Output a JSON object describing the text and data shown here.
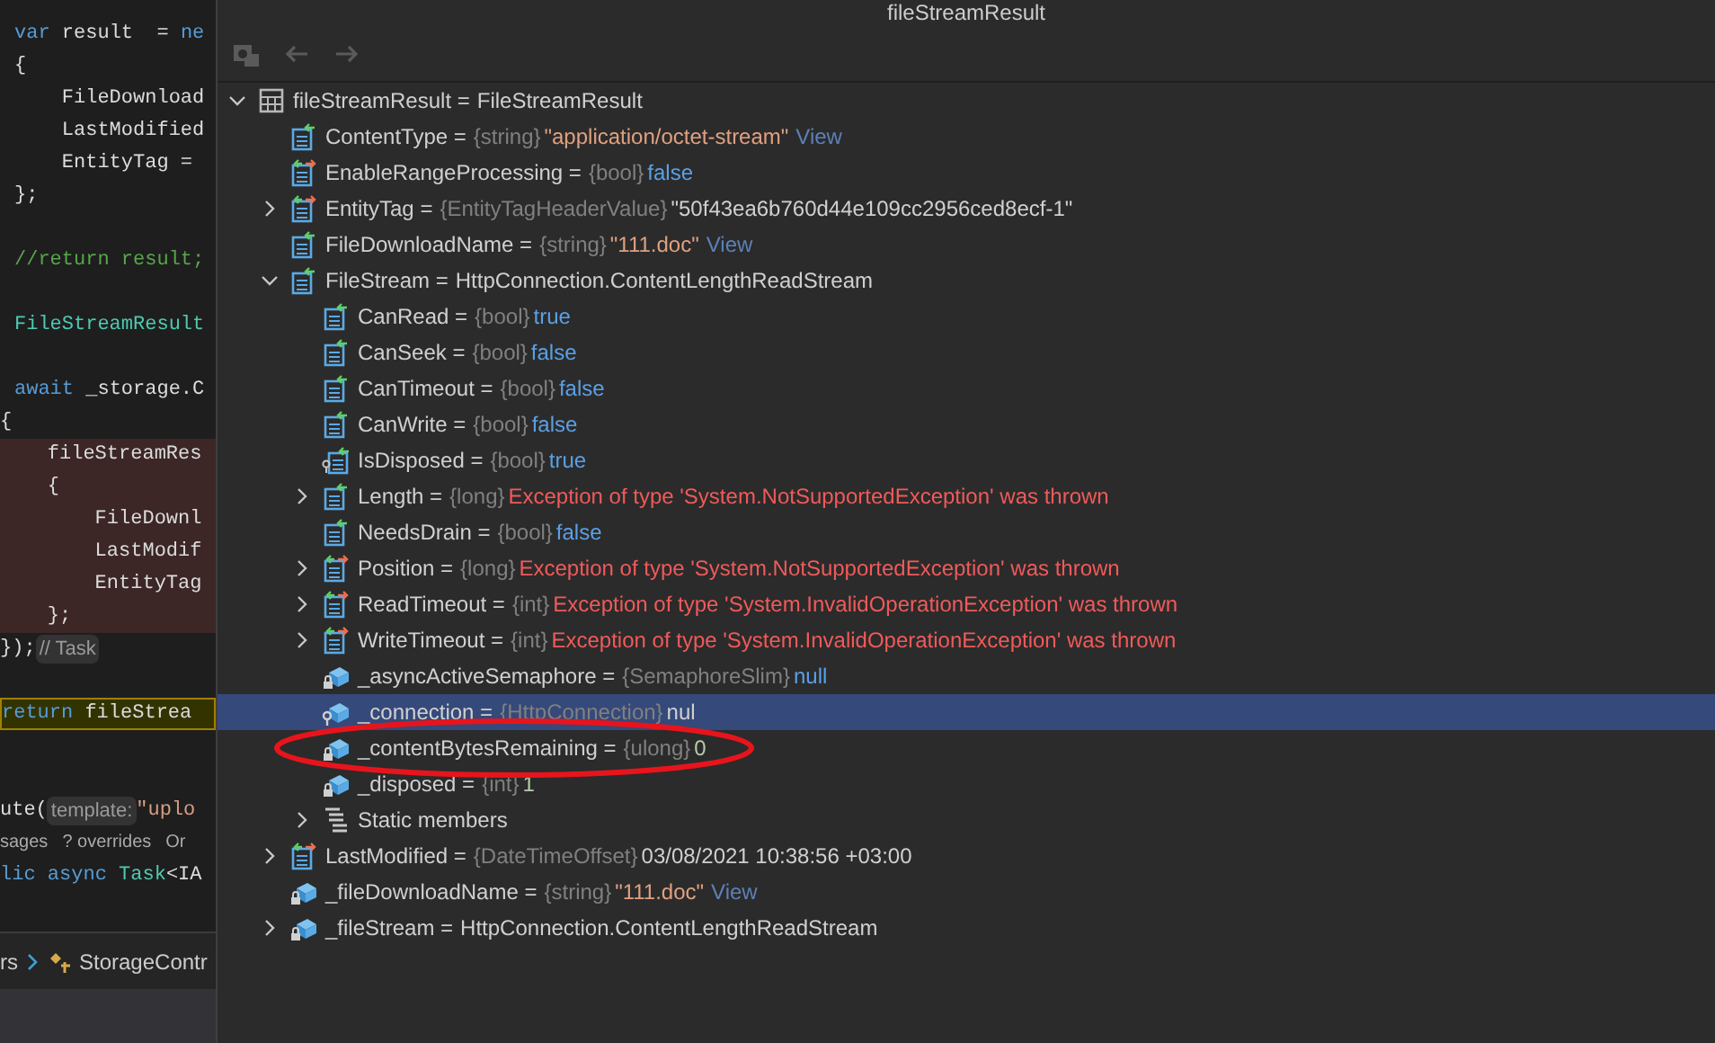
{
  "editor": {
    "lines": [
      {
        "kind": "code",
        "segments": [
          {
            "text": "var",
            "kind": "keyword"
          },
          {
            "text": " result  = ",
            "kind": "plain"
          },
          {
            "text": "ne",
            "kind": "keyword"
          }
        ]
      },
      {
        "kind": "code",
        "segments": [
          {
            "text": "{",
            "kind": "plain"
          }
        ]
      },
      {
        "kind": "code",
        "segments": [
          {
            "text": "    FileDownload",
            "kind": "plain"
          }
        ]
      },
      {
        "kind": "code",
        "segments": [
          {
            "text": "    LastModified",
            "kind": "plain"
          }
        ]
      },
      {
        "kind": "code",
        "segments": [
          {
            "text": "    EntityTag =",
            "kind": "plain"
          }
        ]
      },
      {
        "kind": "code",
        "segments": [
          {
            "text": "};",
            "kind": "plain"
          }
        ]
      },
      {
        "kind": "code"
      },
      {
        "kind": "code",
        "segments": [
          {
            "text": "//return result;",
            "kind": "comment"
          }
        ]
      },
      {
        "kind": "code"
      },
      {
        "kind": "code",
        "segments": [
          {
            "text": "FileStreamResult",
            "kind": "type"
          }
        ]
      },
      {
        "kind": "code"
      },
      {
        "kind": "code",
        "segments": [
          {
            "text": "await",
            "kind": "keyword"
          },
          {
            "text": " _storage.C",
            "kind": "plain"
          }
        ]
      },
      {
        "kind": "outdent",
        "segments": [
          {
            "text": "{",
            "kind": "plain"
          }
        ]
      },
      {
        "kind": "breakpoint",
        "segments": [
          {
            "text": "    fileStreamRes",
            "kind": "plain"
          }
        ]
      },
      {
        "kind": "breakpoint",
        "segments": [
          {
            "text": "    {",
            "kind": "plain"
          }
        ]
      },
      {
        "kind": "breakpoint",
        "segments": [
          {
            "text": "        FileDownl",
            "kind": "plain"
          }
        ]
      },
      {
        "kind": "breakpoint",
        "segments": [
          {
            "text": "        LastModif",
            "kind": "plain"
          }
        ]
      },
      {
        "kind": "breakpoint",
        "segments": [
          {
            "text": "        EntityTag",
            "kind": "plain"
          }
        ]
      },
      {
        "kind": "breakpoint",
        "segments": [
          {
            "text": "    };",
            "kind": "plain"
          }
        ]
      },
      {
        "kind": "outdent",
        "segments": [
          {
            "text": "});",
            "kind": "plain"
          },
          {
            "text": "// Task",
            "kind": "hint"
          }
        ]
      },
      {
        "kind": "code"
      },
      {
        "kind": "current",
        "segments": [
          {
            "text": "return",
            "kind": "keyword"
          },
          {
            "text": " fileStrea",
            "kind": "plain"
          }
        ]
      },
      {
        "kind": "code"
      },
      {
        "kind": "code"
      },
      {
        "kind": "outdent",
        "segments": [
          {
            "text": "ute(",
            "kind": "plain"
          },
          {
            "text": "template:",
            "kind": "hint"
          },
          {
            "text": "\"uplo",
            "kind": "string"
          }
        ]
      },
      {
        "kind": "outdent",
        "segments": [
          {
            "text": "sages",
            "kind": "lens"
          },
          {
            "text": "? overrides",
            "kind": "lens"
          },
          {
            "text": "Or",
            "kind": "lens"
          }
        ]
      },
      {
        "kind": "outdent",
        "segments": [
          {
            "text": "lic",
            "kind": "keyword"
          },
          {
            "text": " async",
            "kind": "keyword"
          },
          {
            "text": " Task",
            "kind": "type"
          },
          {
            "text": "<IA",
            "kind": "plain"
          }
        ]
      }
    ],
    "breadcrumb": [
      {
        "text": "rs"
      },
      {
        "text": "StorageContr"
      }
    ]
  },
  "popup": {
    "title": "fileStreamResult",
    "toolbar": [
      {
        "kind": "folder",
        "disabled": true
      },
      {
        "kind": "back",
        "disabled": true
      },
      {
        "kind": "forward",
        "disabled": true
      }
    ],
    "tree": [
      {
        "kind": "object",
        "label": "fileStreamResult =",
        "value": {
          "kind": "plain",
          "text": "FileStreamResult"
        },
        "expanded": true,
        "selected": false,
        "circled": false,
        "children": [
          {
            "kind": "property",
            "label": "ContentType =",
            "type": "{string}",
            "value": {
              "kind": "string",
              "text": "\"application/octet-stream\""
            },
            "link": "View",
            "selected": false,
            "circled": false
          },
          {
            "kind": "property_rw",
            "label": "EnableRangeProcessing =",
            "type": "{bool}",
            "value": {
              "kind": "keyword",
              "text": "false"
            },
            "selected": false,
            "circled": false
          },
          {
            "kind": "property_rw",
            "label": "EntityTag =",
            "type": "{EntityTagHeaderValue}",
            "value": {
              "kind": "plain",
              "text": "\"50f43ea6b760d44e109cc2956ced8ecf-1\""
            },
            "expanded": false,
            "selected": false,
            "circled": false
          },
          {
            "kind": "property",
            "label": "FileDownloadName =",
            "type": "{string}",
            "value": {
              "kind": "string",
              "text": "\"111.doc\""
            },
            "link": "View",
            "selected": false,
            "circled": false
          },
          {
            "kind": "property",
            "label": "FileStream =",
            "value": {
              "kind": "plain",
              "text": "HttpConnection.ContentLengthReadStream"
            },
            "expanded": true,
            "selected": false,
            "circled": false,
            "children": [
              {
                "kind": "property",
                "label": "CanRead =",
                "type": "{bool}",
                "value": {
                  "kind": "keyword",
                  "text": "true"
                },
                "selected": false,
                "circled": false
              },
              {
                "kind": "property",
                "label": "CanSeek =",
                "type": "{bool}",
                "value": {
                  "kind": "keyword",
                  "text": "false"
                },
                "selected": false,
                "circled": false
              },
              {
                "kind": "property",
                "label": "CanTimeout =",
                "type": "{bool}",
                "value": {
                  "kind": "keyword",
                  "text": "false"
                },
                "selected": false,
                "circled": false
              },
              {
                "kind": "property",
                "label": "CanWrite =",
                "type": "{bool}",
                "value": {
                  "kind": "keyword",
                  "text": "false"
                },
                "selected": false,
                "circled": false
              },
              {
                "kind": "property_internal",
                "label": "IsDisposed =",
                "type": "{bool}",
                "value": {
                  "kind": "keyword",
                  "text": "true"
                },
                "selected": false,
                "circled": false
              },
              {
                "kind": "property",
                "label": "Length =",
                "type": "{long}",
                "value": {
                  "kind": "error",
                  "text": "Exception of type 'System.NotSupportedException' was thrown"
                },
                "expanded": false,
                "selected": false,
                "circled": false
              },
              {
                "kind": "property",
                "label": "NeedsDrain =",
                "type": "{bool}",
                "value": {
                  "kind": "keyword",
                  "text": "false"
                },
                "selected": false,
                "circled": false
              },
              {
                "kind": "property_rw",
                "label": "Position =",
                "type": "{long}",
                "value": {
                  "kind": "error",
                  "text": "Exception of type 'System.NotSupportedException' was thrown"
                },
                "expanded": false,
                "selected": false,
                "circled": false
              },
              {
                "kind": "property_rw",
                "label": "ReadTimeout =",
                "type": "{int}",
                "value": {
                  "kind": "error",
                  "text": "Exception of type 'System.InvalidOperationException' was thrown"
                },
                "expanded": false,
                "selected": false,
                "circled": false
              },
              {
                "kind": "property_rw",
                "label": "WriteTimeout =",
                "type": "{int}",
                "value": {
                  "kind": "error",
                  "text": "Exception of type 'System.InvalidOperationException' was thrown"
                },
                "expanded": false,
                "selected": false,
                "circled": false
              },
              {
                "kind": "field",
                "label": "_asyncActiveSemaphore =",
                "type": "{SemaphoreSlim}",
                "value": {
                  "kind": "keyword",
                  "text": "null"
                },
                "selected": false,
                "circled": false
              },
              {
                "kind": "field_internal",
                "label": "_connection =",
                "type": "{HttpConnection}",
                "value": {
                  "kind": "plain",
                  "text": "nul"
                },
                "selected": true,
                "circled": false
              },
              {
                "kind": "field",
                "label": "_contentBytesRemaining =",
                "type": "{ulong}",
                "value": {
                  "kind": "number",
                  "text": "0"
                },
                "selected": false,
                "circled": true
              },
              {
                "kind": "field",
                "label": "_disposed =",
                "type": "{int}",
                "value": {
                  "kind": "number",
                  "text": "1"
                },
                "selected": false,
                "circled": false
              },
              {
                "kind": "static",
                "label": "Static members",
                "expanded": false,
                "selected": false,
                "circled": false
              }
            ]
          },
          {
            "kind": "property_rw",
            "label": "LastModified =",
            "type": "{DateTimeOffset}",
            "value": {
              "kind": "plain",
              "text": "03/08/2021 10:38:56 +03:00"
            },
            "expanded": false,
            "selected": false,
            "circled": false
          },
          {
            "kind": "field",
            "label": "_fileDownloadName =",
            "type": "{string}",
            "value": {
              "kind": "string",
              "text": "\"111.doc\""
            },
            "link": "View",
            "selected": false,
            "circled": false
          },
          {
            "kind": "field",
            "label": "_fileStream =",
            "value": {
              "kind": "plain",
              "text": "HttpConnection.ContentLengthReadStream"
            },
            "expanded": false,
            "selected": false,
            "circled": false
          }
        ]
      }
    ]
  }
}
